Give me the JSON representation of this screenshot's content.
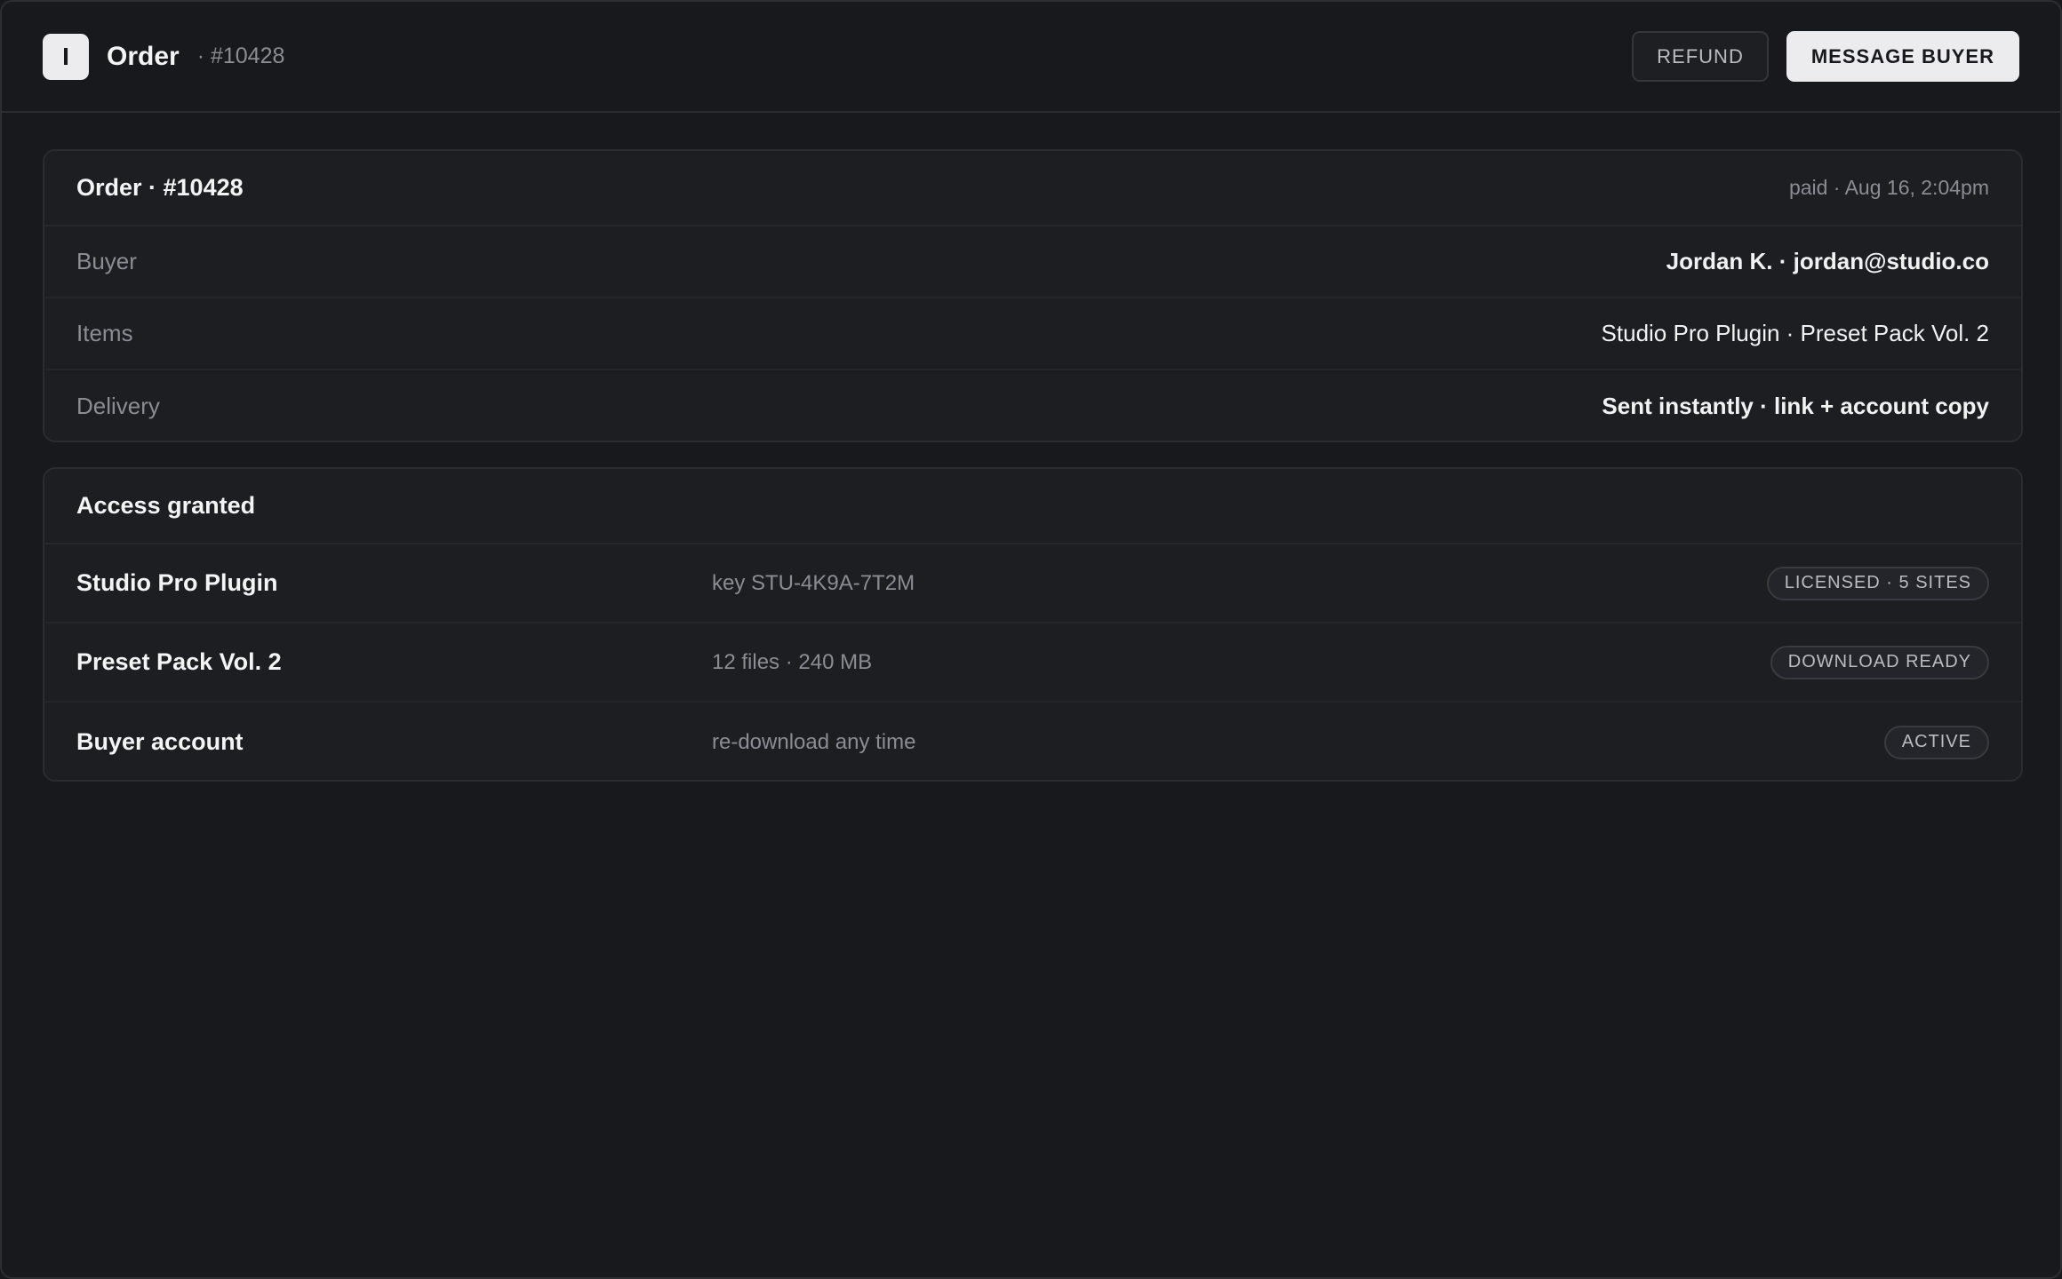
{
  "header": {
    "logo_letter": "I",
    "title": "Order",
    "order_crumb": "· #10428",
    "refund_label": "REFUND",
    "message_label": "MESSAGE BUYER"
  },
  "order_card": {
    "title": "Order · #10428",
    "meta": "paid · Aug 16, 2:04pm",
    "rows": [
      {
        "label": "Buyer",
        "value": "Jordan K. · jordan@studio.co"
      },
      {
        "label": "Items",
        "value": "Studio Pro Plugin · Preset Pack Vol. 2"
      },
      {
        "label": "Delivery",
        "value": "Sent instantly · link + account copy"
      }
    ]
  },
  "access_card": {
    "title": "Access granted",
    "rows": [
      {
        "name": "Studio Pro Plugin",
        "detail": "key STU-4K9A-7T2M",
        "badge": "LICENSED · 5 SITES"
      },
      {
        "name": "Preset Pack Vol. 2",
        "detail": "12 files · 240 MB",
        "badge": "DOWNLOAD READY"
      },
      {
        "name": "Buyer account",
        "detail": "re-download any time",
        "badge": "ACTIVE"
      }
    ]
  },
  "colors": {
    "background": "#18191c",
    "card": "#1c1e22",
    "primary_button": "#ececee",
    "muted_text": "#8a8d94"
  }
}
